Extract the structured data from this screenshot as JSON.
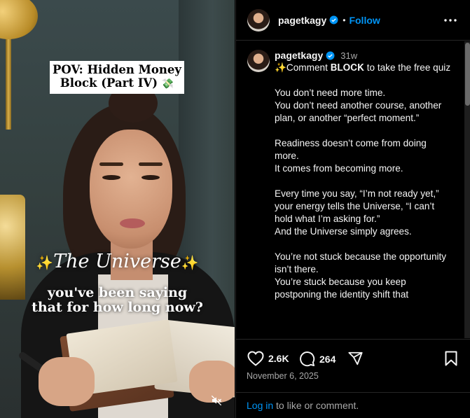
{
  "media": {
    "caption_line1": "POV: Hidden Money",
    "caption_line2": "Block (Part IV)",
    "caption_emoji": "💸",
    "overlay_title": "The Universe",
    "overlay_sparkle": "✨",
    "overlay_sub_line1": "you've been saying",
    "overlay_sub_line2": "that for how long now?",
    "mute_icon": "muted-speaker-icon"
  },
  "header": {
    "username": "pagetkagy",
    "separator": "•",
    "follow_label": "Follow",
    "more_icon": "more-options-icon"
  },
  "post": {
    "username": "pagetkagy",
    "time": "31w",
    "caption": "✨Comment 𝐁𝐋𝐎𝐂𝐊 to take the free quiz\n\nYou don’t need more time.\nYou don’t need another course, another plan, or another “perfect moment.”\n\nReadiness doesn’t come from doing more.\nIt comes from becoming more.\n\nEvery time you say, “I’m not ready yet,”\nyour energy tells the Universe, “I can’t hold what I’m asking for.”\nAnd the Universe simply agrees.\n\nYou’re not stuck because the opportunity isn’t there.\nYou’re stuck because you keep postponing the identity shift that"
  },
  "actions": {
    "likes": "2.6K",
    "comments": "264",
    "date": "November 6, 2025",
    "login_link": "Log in",
    "login_rest": " to like or comment."
  },
  "colors": {
    "accent": "#0095f6",
    "verified": "#0095f6",
    "secondary_text": "#a8a8a8",
    "background": "#000000"
  }
}
